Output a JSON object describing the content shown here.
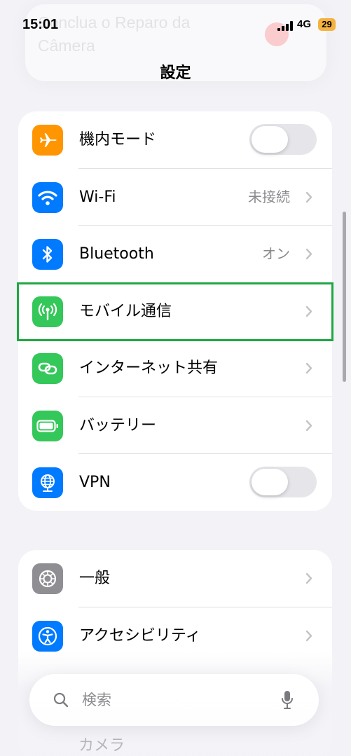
{
  "status_bar": {
    "time": "15:01",
    "network": "4G",
    "battery": "29"
  },
  "background_notification": {
    "text": "Conclua o Reparo da Câmera"
  },
  "header": {
    "title": "設定"
  },
  "group1": {
    "airplane": {
      "label": "機内モード",
      "toggle_on": false,
      "icon": "airplane-icon"
    },
    "wifi": {
      "label": "Wi-Fi",
      "value": "未接続",
      "icon": "wifi-icon"
    },
    "bluetooth": {
      "label": "Bluetooth",
      "value": "オン",
      "icon": "bluetooth-icon"
    },
    "mobile": {
      "label": "モバイル通信",
      "icon": "antenna-icon"
    },
    "hotspot": {
      "label": "インターネット共有",
      "icon": "link-icon"
    },
    "battery": {
      "label": "バッテリー",
      "icon": "battery-icon"
    },
    "vpn": {
      "label": "VPN",
      "toggle_on": false,
      "icon": "globe-icon"
    }
  },
  "group2": {
    "general": {
      "label": "一般",
      "icon": "gear-icon"
    },
    "accessibility": {
      "label": "アクセシビリティ",
      "icon": "accessibility-icon"
    },
    "ghost_row_label": "カメラ"
  },
  "search": {
    "placeholder": "検索"
  },
  "colors": {
    "orange": "#ff9500",
    "blue": "#007aff",
    "green": "#34c759",
    "gray": "#8e8e93",
    "highlight": "#1fa743"
  }
}
